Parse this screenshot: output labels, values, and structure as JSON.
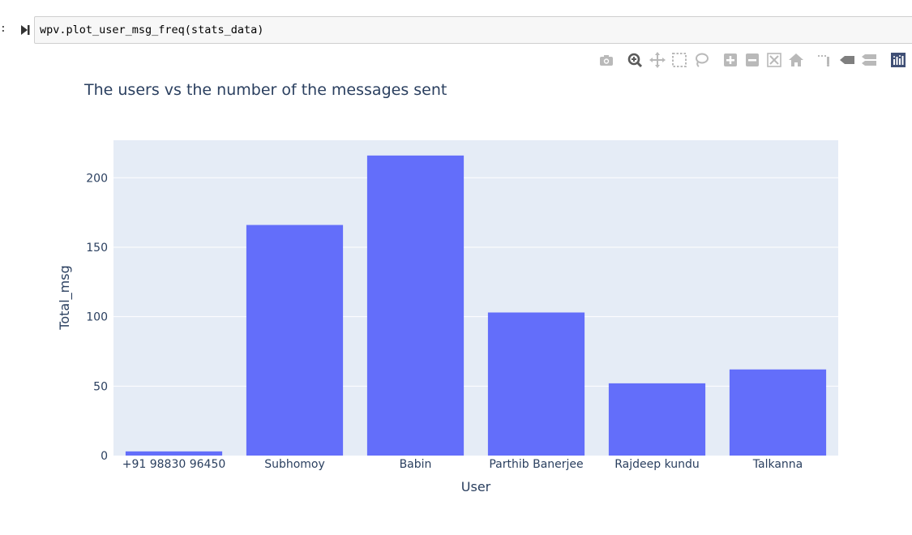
{
  "notebook": {
    "prompt": ":",
    "code": "wpv.plot_user_msg_freq(stats_data)"
  },
  "modebar": {
    "buttons": [
      {
        "icon": "camera-icon"
      },
      {
        "icon": "zoom-icon"
      },
      {
        "icon": "pan-icon"
      },
      {
        "icon": "box-select-icon"
      },
      {
        "icon": "lasso-select-icon"
      },
      {
        "icon": "zoom-in-icon"
      },
      {
        "icon": "zoom-out-icon"
      },
      {
        "icon": "autoscale-icon"
      },
      {
        "icon": "reset-axes-icon"
      },
      {
        "icon": "toggle-spike-lines-icon"
      },
      {
        "icon": "hover-closest-icon"
      },
      {
        "icon": "hover-compare-icon"
      },
      {
        "icon": "plotly-logo-icon"
      }
    ]
  },
  "colors": {
    "bar": "#636efa",
    "plot_bg": "#e5ecf6",
    "grid": "#ffffff",
    "text": "#2a3f5f"
  },
  "chart_data": {
    "type": "bar",
    "title": "The users vs the number of the messages sent",
    "xlabel": "User",
    "ylabel": "Total_msg",
    "categories": [
      "+91 98830 96450",
      "Subhomoy",
      "Babin",
      "Parthib Banerjee",
      "Rajdeep kundu",
      "Talkanna"
    ],
    "values": [
      3,
      166,
      216,
      103,
      52,
      62
    ],
    "ylim": [
      0,
      227
    ],
    "yticks": [
      0,
      50,
      100,
      150,
      200
    ],
    "grid": true,
    "legend": false
  }
}
